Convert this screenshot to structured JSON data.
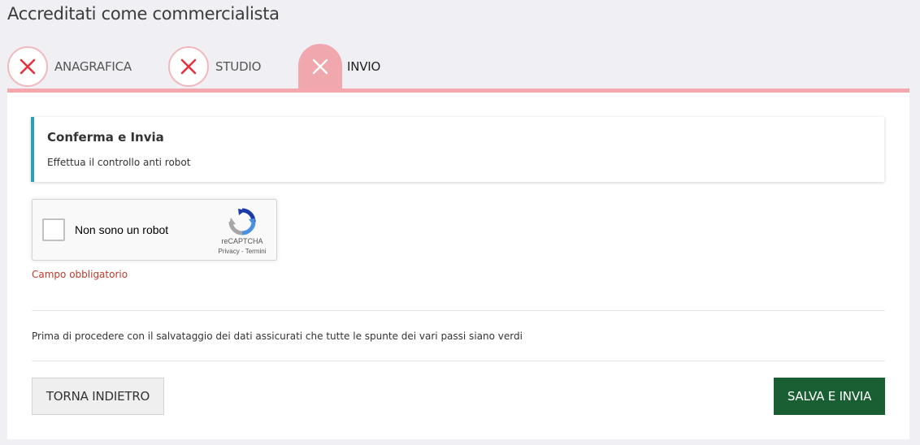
{
  "page": {
    "title": "Accreditati come commercialista"
  },
  "tabs": [
    {
      "label": "ANAGRAFICA",
      "icon": "close-icon",
      "state": "error"
    },
    {
      "label": "STUDIO",
      "icon": "close-icon",
      "state": "error"
    },
    {
      "label": "INVIO",
      "icon": "close-icon",
      "state": "active"
    }
  ],
  "info_box": {
    "title": "Conferma e Invia",
    "text": "Effettua il controllo anti robot"
  },
  "recaptcha": {
    "label": "Non sono un robot",
    "brand": "reCAPTCHA",
    "links": "Privacy - Termini",
    "icon": "recaptcha-logo-icon"
  },
  "error_text": "Campo obbligatorio",
  "note": "Prima di procedere con il salvataggio dei dati assicurati che tutte le spunte dei vari passi siano verdi",
  "buttons": {
    "back": "TORNA INDIETRO",
    "save": "SALVA E INVIA"
  },
  "colors": {
    "error_red": "#e2323f",
    "tab_active": "#f0a8ae",
    "info_accent": "#2a9fb6",
    "save_button": "#1a5f34"
  }
}
